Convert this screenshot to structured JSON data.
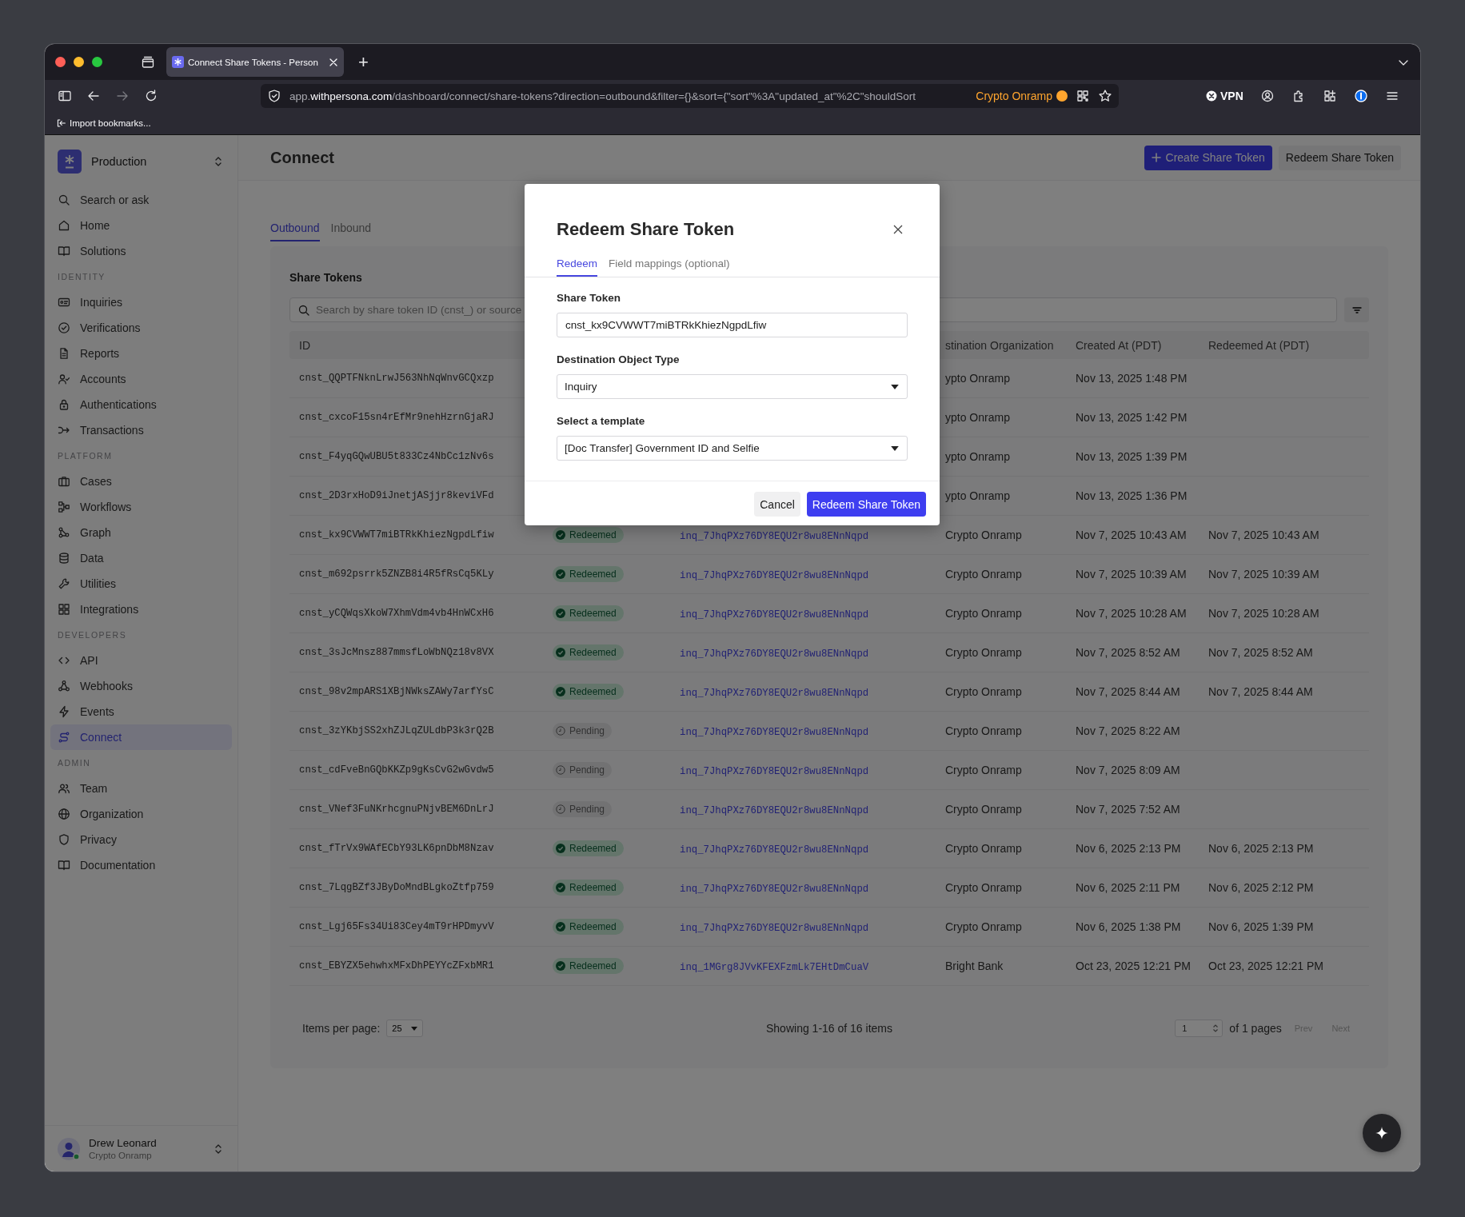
{
  "browser": {
    "tabs": [
      {
        "title": "Connect Share Tokens - Person",
        "selected": true
      }
    ],
    "new_tab": "+",
    "forward_button": {
      "disabled": true
    },
    "url": {
      "prefix": "app.",
      "domain": "withpersona.com",
      "path": "/dashboard/connect/share-tokens?direction=outbound&filter={}&sort={\"sort\"%3A\"updated_at\"%2C\"shouldSort"
    },
    "site_badge": "Crypto Onramp",
    "vpn": "VPN",
    "bookmarks": [
      "Import bookmarks..."
    ]
  },
  "sidebar": {
    "workspace": "Production",
    "sections": [
      {
        "items": [
          {
            "label": "Search or ask",
            "selected": false
          },
          {
            "label": "Home",
            "selected": false
          },
          {
            "label": "Solutions",
            "selected": false
          }
        ]
      },
      {
        "label": "IDENTITY",
        "items": [
          {
            "label": "Inquiries",
            "selected": false
          },
          {
            "label": "Verifications",
            "selected": false
          },
          {
            "label": "Reports",
            "selected": false
          },
          {
            "label": "Accounts",
            "selected": false
          },
          {
            "label": "Authentications",
            "selected": false
          },
          {
            "label": "Transactions",
            "selected": false
          }
        ]
      },
      {
        "label": "PLATFORM",
        "items": [
          {
            "label": "Cases",
            "selected": false
          },
          {
            "label": "Workflows",
            "selected": false
          },
          {
            "label": "Graph",
            "selected": false
          },
          {
            "label": "Data",
            "selected": false
          },
          {
            "label": "Utilities",
            "selected": false
          },
          {
            "label": "Integrations",
            "selected": false
          }
        ]
      },
      {
        "label": "DEVELOPERS",
        "items": [
          {
            "label": "API",
            "selected": false
          },
          {
            "label": "Webhooks",
            "selected": false
          },
          {
            "label": "Events",
            "selected": false
          },
          {
            "label": "Connect",
            "selected": true
          }
        ]
      },
      {
        "label": "ADMIN",
        "items": [
          {
            "label": "Team",
            "selected": false
          },
          {
            "label": "Organization",
            "selected": false
          },
          {
            "label": "Privacy",
            "selected": false
          },
          {
            "label": "Documentation",
            "selected": false
          }
        ]
      }
    ],
    "user": {
      "name": "Drew Leonard",
      "organization": "Crypto Onramp"
    }
  },
  "page": {
    "title": "Connect",
    "actions": [
      {
        "label": "Create Share Token",
        "kind": "primary"
      },
      {
        "label": "Redeem Share Token",
        "kind": "secondary"
      }
    ],
    "tabs": [
      {
        "label": "Outbound",
        "selected": true
      },
      {
        "label": "Inbound",
        "selected": false
      }
    ]
  },
  "share_tokens": {
    "title": "Share Tokens",
    "search": {
      "placeholder": "Search by share token ID (cnst_) or source"
    },
    "columns": {
      "id": "ID",
      "destination_organization": "stination Organization",
      "created_at": "Created At (PDT)",
      "redeemed_at": "Redeemed At (PDT)"
    },
    "rows": [
      {
        "id": "cnst_QQPTFNknLrwJ563NhNqWnvGCQxzp",
        "organization": "ypto Onramp",
        "created_at": "Nov 13, 2025 1:48 PM"
      },
      {
        "id": "cnst_cxcoF15sn4rEfMr9nehHzrnGjaRJ",
        "organization": "ypto Onramp",
        "created_at": "Nov 13, 2025 1:42 PM"
      },
      {
        "id": "cnst_F4yqGQwUBU5t833Cz4NbCc1zNv6s",
        "organization": "ypto Onramp",
        "created_at": "Nov 13, 2025 1:39 PM"
      },
      {
        "id": "cnst_2D3rxHoD9iJnetjASjjr8keviVFd",
        "organization": "ypto Onramp",
        "created_at": "Nov 13, 2025 1:36 PM"
      },
      {
        "id": "cnst_kx9CVWWT7miBTRkKhiezNgpdLfiw",
        "status": {
          "label": "Redeemed",
          "kind": "redeemed"
        },
        "inquiry": "inq_7JhqPXz76DY8EQU2r8wu8ENnNqpd",
        "organization": "Crypto Onramp",
        "created_at": "Nov 7, 2025 10:43 AM",
        "redeemed_at": "Nov 7, 2025 10:43 AM"
      },
      {
        "id": "cnst_m692psrrk5ZNZB8i4R5fRsCq5KLy",
        "status": {
          "label": "Redeemed",
          "kind": "redeemed"
        },
        "inquiry": "inq_7JhqPXz76DY8EQU2r8wu8ENnNqpd",
        "organization": "Crypto Onramp",
        "created_at": "Nov 7, 2025 10:39 AM",
        "redeemed_at": "Nov 7, 2025 10:39 AM"
      },
      {
        "id": "cnst_yCQWqsXkoW7XhmVdm4vb4HnWCxH6",
        "status": {
          "label": "Redeemed",
          "kind": "redeemed"
        },
        "inquiry": "inq_7JhqPXz76DY8EQU2r8wu8ENnNqpd",
        "organization": "Crypto Onramp",
        "created_at": "Nov 7, 2025 10:28 AM",
        "redeemed_at": "Nov 7, 2025 10:28 AM"
      },
      {
        "id": "cnst_3sJcMnsz887mmsfLoWbNQz18v8VX",
        "status": {
          "label": "Redeemed",
          "kind": "redeemed"
        },
        "inquiry": "inq_7JhqPXz76DY8EQU2r8wu8ENnNqpd",
        "organization": "Crypto Onramp",
        "created_at": "Nov 7, 2025 8:52 AM",
        "redeemed_at": "Nov 7, 2025 8:52 AM"
      },
      {
        "id": "cnst_98v2mpARS1XBjNWksZAWy7arfYsC",
        "status": {
          "label": "Redeemed",
          "kind": "redeemed"
        },
        "inquiry": "inq_7JhqPXz76DY8EQU2r8wu8ENnNqpd",
        "organization": "Crypto Onramp",
        "created_at": "Nov 7, 2025 8:44 AM",
        "redeemed_at": "Nov 7, 2025 8:44 AM"
      },
      {
        "id": "cnst_3zYKbjSS2xhZJLqZULdbP3k3rQ2B",
        "status": {
          "label": "Pending",
          "kind": "pending"
        },
        "inquiry": "inq_7JhqPXz76DY8EQU2r8wu8ENnNqpd",
        "organization": "Crypto Onramp",
        "created_at": "Nov 7, 2025 8:22 AM"
      },
      {
        "id": "cnst_cdFveBnGQbKKZp9gKsCvG2wGvdw5",
        "status": {
          "label": "Pending",
          "kind": "pending"
        },
        "inquiry": "inq_7JhqPXz76DY8EQU2r8wu8ENnNqpd",
        "organization": "Crypto Onramp",
        "created_at": "Nov 7, 2025 8:09 AM"
      },
      {
        "id": "cnst_VNef3FuNKrhcgnuPNjvBEM6DnLrJ",
        "status": {
          "label": "Pending",
          "kind": "pending"
        },
        "inquiry": "inq_7JhqPXz76DY8EQU2r8wu8ENnNqpd",
        "organization": "Crypto Onramp",
        "created_at": "Nov 7, 2025 7:52 AM"
      },
      {
        "id": "cnst_fTrVx9WAfECbY93LK6pnDbM8Nzav",
        "status": {
          "label": "Redeemed",
          "kind": "redeemed"
        },
        "inquiry": "inq_7JhqPXz76DY8EQU2r8wu8ENnNqpd",
        "organization": "Crypto Onramp",
        "created_at": "Nov 6, 2025 2:13 PM",
        "redeemed_at": "Nov 6, 2025 2:13 PM"
      },
      {
        "id": "cnst_7LqgBZf3JByDoMndBLgkoZtfp759",
        "status": {
          "label": "Redeemed",
          "kind": "redeemed"
        },
        "inquiry": "inq_7JhqPXz76DY8EQU2r8wu8ENnNqpd",
        "organization": "Crypto Onramp",
        "created_at": "Nov 6, 2025 2:11 PM",
        "redeemed_at": "Nov 6, 2025 2:12 PM"
      },
      {
        "id": "cnst_Lgj65Fs34Ui83Cey4mT9rHPDmyvV",
        "status": {
          "label": "Redeemed",
          "kind": "redeemed"
        },
        "inquiry": "inq_7JhqPXz76DY8EQU2r8wu8ENnNqpd",
        "organization": "Crypto Onramp",
        "created_at": "Nov 6, 2025 1:38 PM",
        "redeemed_at": "Nov 6, 2025 1:39 PM"
      },
      {
        "id": "cnst_EBYZX5ehwhxMFxDhPEYYcZFxbMR1",
        "status": {
          "label": "Redeemed",
          "kind": "redeemed"
        },
        "inquiry": "inq_1MGrg8JVvKFEXFzmLk7EHtDmCuaV",
        "organization": "Bright Bank",
        "created_at": "Oct 23, 2025 12:21 PM",
        "redeemed_at": "Oct 23, 2025 12:21 PM"
      }
    ],
    "footer": {
      "items_per_page_label": "Items per page:",
      "items_per_page": "25",
      "summary": "Showing 1-16 of 16 items",
      "page": "1",
      "page_total": "of 1 pages",
      "pager": [
        {
          "label": "Prev",
          "disabled": true
        },
        {
          "label": "Next",
          "disabled": true
        }
      ]
    }
  },
  "modal": {
    "title": "Redeem Share Token",
    "tabs": [
      {
        "label": "Redeem",
        "selected": true
      },
      {
        "label": "Field mappings (optional)",
        "selected": false
      }
    ],
    "fields": [
      {
        "label": "Share Token",
        "kind": "text",
        "value": "cnst_kx9CVWWT7miBTRkKhiezNgpdLfiw"
      },
      {
        "label": "Destination Object Type",
        "kind": "select",
        "value": "Inquiry"
      },
      {
        "label": "Select a template",
        "kind": "select",
        "value": "[Doc Transfer] Government ID and Selfie"
      }
    ],
    "buttons": [
      {
        "label": "Cancel",
        "kind": "secondary"
      },
      {
        "label": "Redeem Share Token",
        "kind": "primary"
      }
    ]
  }
}
